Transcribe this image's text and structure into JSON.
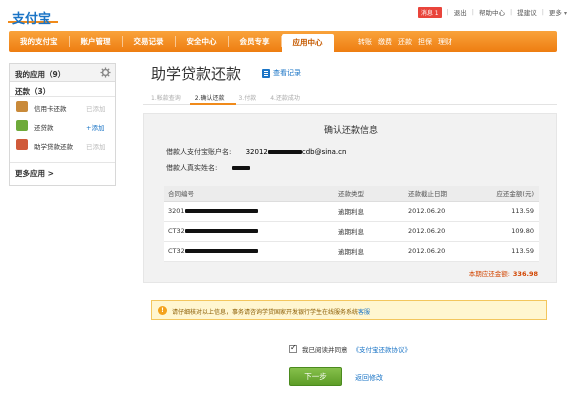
{
  "brand": {
    "logo_text": "支付宝"
  },
  "toplinks": {
    "msg_label": "消息",
    "msg_count": "1",
    "logout": "退出",
    "help": "帮助中心",
    "suggest": "提建议",
    "more": "更多"
  },
  "nav": {
    "items": [
      "我的支付宝",
      "账户管理",
      "交易记录",
      "安全中心",
      "会员专享",
      "应用中心"
    ],
    "active_index": 5,
    "sub": [
      "转账",
      "缴费",
      "还款",
      "担保",
      "理财"
    ]
  },
  "sidebar": {
    "title": "我的应用（9）",
    "section": "还款（3）",
    "apps": [
      {
        "label": "信用卡还款",
        "action": "已添加",
        "icon_color": "#c98a3a",
        "action_active": false
      },
      {
        "label": "还贷款",
        "action": "+添加",
        "icon_color": "#6eaa3a",
        "action_active": true
      },
      {
        "label": "助学贷款还款",
        "action": "已添加",
        "icon_color": "#d05a3a",
        "action_active": false
      }
    ],
    "more": "更多应用 >"
  },
  "main": {
    "title": "助学贷款还款",
    "history_link": "查看记录",
    "steps": [
      "1.帐款查询",
      "2.确认还款",
      "3.付款",
      "4.还款成功"
    ],
    "current_step": 1,
    "panel_title": "确认还款信息",
    "account_label": "借款人支付宝账户名:",
    "account_prefix": "32012",
    "account_suffix": "cdb@sina.cn",
    "name_label": "借款人真实姓名:",
    "table": {
      "headers": [
        "合同编号",
        "还款类型",
        "还款截止日期",
        "应还金额(元)"
      ],
      "rows": [
        {
          "id_prefix": "3201",
          "type": "逾期利息",
          "date": "2012.06.20",
          "amount": "113.59"
        },
        {
          "id_prefix": "CT32",
          "type": "逾期利息",
          "date": "2012.06.20",
          "amount": "109.80"
        },
        {
          "id_prefix": "CT32",
          "type": "逾期利息",
          "date": "2012.06.20",
          "amount": "113.59"
        }
      ]
    },
    "total_label": "本期应还金额:",
    "total_value": "336.98",
    "notice": "请仔细核对以上信息，事务请咨询学贷国家开发银行学生在线服务系统",
    "notice_link": "客服",
    "agree_text": "我已阅读并同意",
    "agree_link": "《支付宝还款协议》",
    "next_btn": "下一步",
    "back_link": "返回修改"
  }
}
